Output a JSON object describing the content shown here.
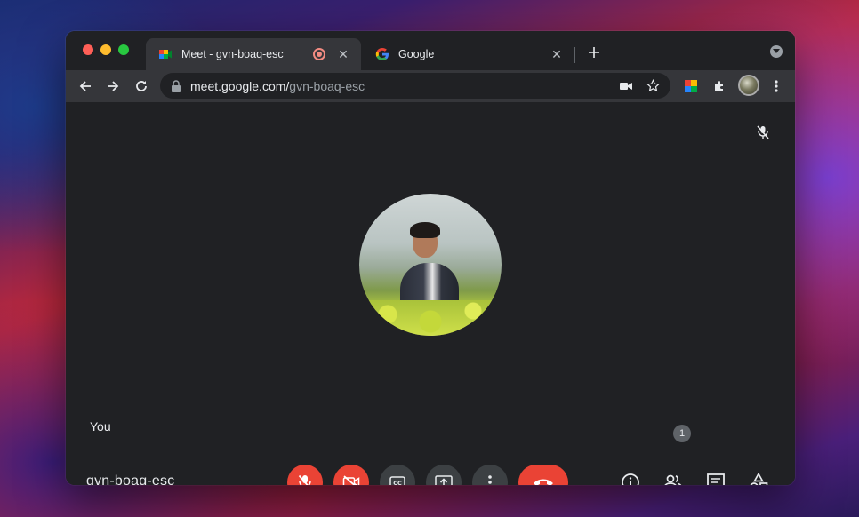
{
  "browser": {
    "tabs": [
      {
        "title": "Meet - gvn-boaq-esc",
        "active": true
      },
      {
        "title": "Google",
        "active": false
      }
    ],
    "url": {
      "host": "meet.google.com/",
      "path": "gvn-boaq-esc"
    },
    "new_tab_symbol": "+",
    "close_symbol": "✕"
  },
  "meet": {
    "self_label": "You",
    "meeting_code": "gvn-boaq-esc",
    "participant_count": "1"
  },
  "icons": {
    "meet": "google-meet-icon",
    "google": "google-g-icon",
    "recording": "recording-dot-icon",
    "mic_off": "mic-off-icon",
    "camera_off": "camera-off-icon",
    "captions": "closed-captions-icon",
    "present": "present-screen-icon",
    "more": "more-vert-icon",
    "end_call": "hang-up-icon",
    "info": "info-icon",
    "people": "people-icon",
    "chat": "chat-icon",
    "activities": "activities-icon"
  },
  "colors": {
    "accent_red": "#ea4335",
    "control_grey": "#3c4043",
    "background": "#202124"
  }
}
